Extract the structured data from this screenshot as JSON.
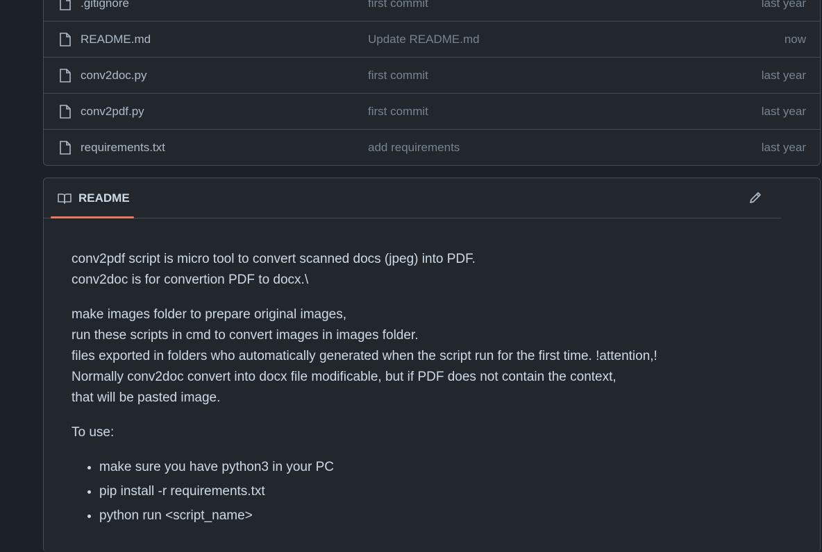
{
  "files": [
    {
      "name": ".gitignore",
      "message": "first commit",
      "time": "last year"
    },
    {
      "name": "README.md",
      "message": "Update README.md",
      "time": "now"
    },
    {
      "name": "conv2doc.py",
      "message": "first commit",
      "time": "last year"
    },
    {
      "name": "conv2pdf.py",
      "message": "first commit",
      "time": "last year"
    },
    {
      "name": "requirements.txt",
      "message": "add requirements",
      "time": "last year"
    }
  ],
  "readme": {
    "title": "README",
    "para1": [
      "conv2pdf script is micro tool to convert scanned docs (jpeg) into PDF.",
      "conv2doc is for convertion PDF to docx.\\"
    ],
    "para2": [
      "make images folder to prepare original images,",
      "run these scripts in cmd to convert images in images folder.",
      "files exported in folders who automatically generated when the script run for the first time. !attention,!",
      "Normally conv2doc convert into docx file modificable, but if PDF does not contain the context,",
      "that will be pasted image."
    ],
    "para3": "To use:",
    "list": [
      "make sure you have python3 in your PC",
      "pip install -r requirements.txt",
      "python run <script_name>"
    ]
  },
  "icons": {
    "file": "file-icon",
    "book": "book-icon",
    "edit": "pencil-icon"
  },
  "colors": {
    "accent": "#ec775c",
    "bg": "#22272e",
    "border": "#444c56"
  }
}
